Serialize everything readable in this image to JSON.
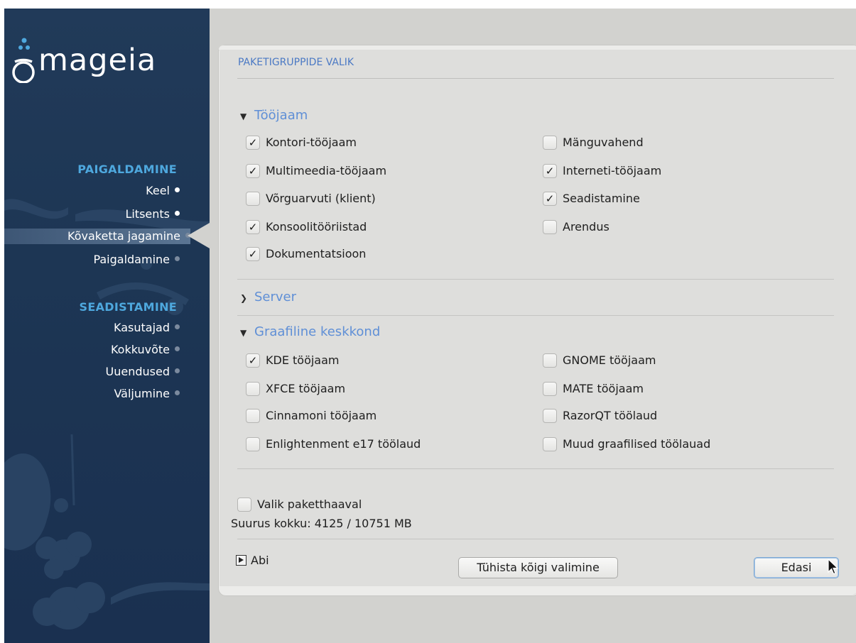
{
  "brand": {
    "logo_text": "mageia"
  },
  "sidebar": {
    "section1": "PAIGALDAMINE",
    "section1_items": [
      {
        "label": "Keel",
        "state": "done"
      },
      {
        "label": "Litsents",
        "state": "done"
      },
      {
        "label": "Kõvaketta jagamine",
        "state": "active"
      },
      {
        "label": "Paigaldamine",
        "state": "pending"
      }
    ],
    "section2": "SEADISTAMINE",
    "section2_items": [
      {
        "label": "Kasutajad",
        "state": "pending"
      },
      {
        "label": "Kokkuvõte",
        "state": "pending"
      },
      {
        "label": "Uuendused",
        "state": "pending"
      },
      {
        "label": "Väljumine",
        "state": "pending"
      }
    ]
  },
  "dialog": {
    "title": "PAKETIGRUPPIDE VALIK",
    "groups": [
      {
        "name": "Tööjaam",
        "expanded": true,
        "items": [
          {
            "label": "Kontori-tööjaam",
            "checked": true
          },
          {
            "label": "Mänguvahend",
            "checked": false
          },
          {
            "label": "Multimeedia-tööjaam",
            "checked": true
          },
          {
            "label": "Interneti-tööjaam",
            "checked": true
          },
          {
            "label": "Võrguarvuti (klient)",
            "checked": false
          },
          {
            "label": "Seadistamine",
            "checked": true
          },
          {
            "label": "Konsoolitööriistad",
            "checked": true
          },
          {
            "label": "Arendus",
            "checked": false
          },
          {
            "label": "Dokumentatsioon",
            "checked": true
          }
        ]
      },
      {
        "name": "Server",
        "expanded": false,
        "items": []
      },
      {
        "name": "Graafiline keskkond",
        "expanded": true,
        "items": [
          {
            "label": "KDE tööjaam",
            "checked": true
          },
          {
            "label": "GNOME tööjaam",
            "checked": false
          },
          {
            "label": "XFCE tööjaam",
            "checked": false
          },
          {
            "label": "MATE tööjaam",
            "checked": false
          },
          {
            "label": "Cinnamoni tööjaam",
            "checked": false
          },
          {
            "label": "RazorQT töölaud",
            "checked": false
          },
          {
            "label": "Enlightenment e17 töölaud",
            "checked": false
          },
          {
            "label": "Muud graafilised töölauad",
            "checked": false
          }
        ]
      }
    ],
    "individual_selection": {
      "label": "Valik paketthaaval",
      "checked": false
    },
    "size_text": "Suurus kokku: 4125 / 10751 MB",
    "help_label": "Abi",
    "deselect_all_label": "Tühista kõigi valimine",
    "next_label": "Edasi"
  },
  "colors": {
    "sidebar_bg": "#1d3654",
    "section_heading": "#4ea8de",
    "group_header": "#5f8fd6",
    "title": "#4b79c4",
    "panel_bg": "#dededc"
  },
  "icons": {
    "checked": "check-mark",
    "expanded": "chevron-down",
    "collapsed": "chevron-right",
    "help": "play-triangle",
    "cursor": "arrow-pointer"
  }
}
